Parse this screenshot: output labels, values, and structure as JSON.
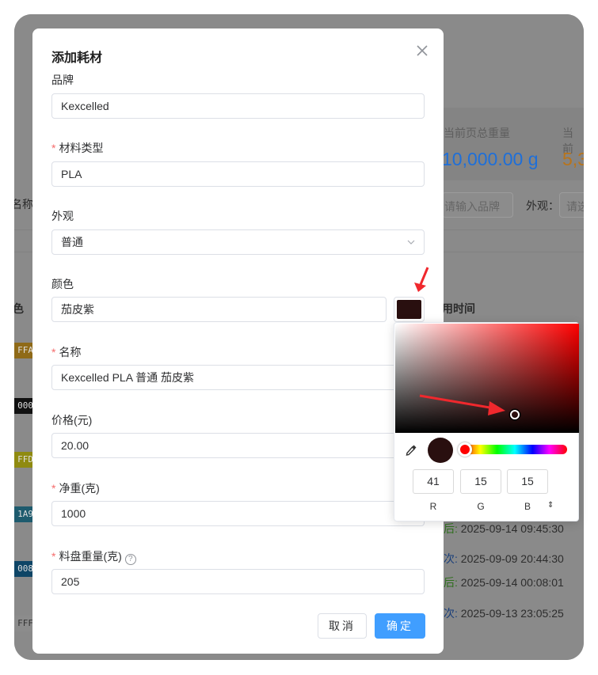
{
  "background": {
    "stat1_label": "当前页总重量",
    "stat1_value": "10,000.00 g",
    "stat1_color": "#1e6fd9",
    "stat2_label": "当前",
    "stat2_value": "5,3",
    "stat2_color": "#b9741a",
    "left_name_label": "名称",
    "brand_placeholder": "请输入品牌",
    "appearance_label": "外观：",
    "appearance_placeholder": "请选",
    "col_color": "色",
    "col_time": "用时间",
    "chips": [
      {
        "text": "FFA",
        "color": "#8f6a18"
      },
      {
        "text": "000",
        "color": "#111111"
      },
      {
        "text": "FFD",
        "color": "#8f8a10"
      },
      {
        "text": "1A9",
        "color": "#1e5b6e"
      },
      {
        "text": "008",
        "color": "#0e4566"
      },
      {
        "text": "FFF",
        "color": "#8c8c8c"
      }
    ],
    "rows": [
      {
        "tag": "后:",
        "time": "2025-09-14 09:45:30"
      },
      {
        "tag": "次:",
        "time": "2025-09-09 20:44:30"
      },
      {
        "tag": "后:",
        "time": "2025-09-14 00:08:01"
      },
      {
        "tag": "次:",
        "time": "2025-09-13 23:05:25"
      }
    ]
  },
  "dialog": {
    "title": "添加耗材",
    "fields": {
      "brand": {
        "label": "品牌",
        "value": "Kexcelled"
      },
      "material_type": {
        "label": "材料类型",
        "value": "PLA",
        "required": true
      },
      "appearance": {
        "label": "外观",
        "value": "普通"
      },
      "color": {
        "label": "颜色",
        "value": "茄皮紫",
        "swatch": "#290f0f"
      },
      "name": {
        "label": "名称",
        "value": "Kexcelled PLA 普通 茄皮紫",
        "required": true
      },
      "price": {
        "label": "价格(元)",
        "value": "20.00"
      },
      "net_weight": {
        "label": "净重(克)",
        "value": "1000",
        "required": true
      },
      "spool_weight": {
        "label": "料盘重量(克)",
        "value": "205",
        "required": true
      }
    },
    "cancel_label": "取消",
    "ok_label": "确定",
    "ok_color": "#409eff"
  },
  "color_picker": {
    "hue_color": "#ff0000",
    "current_color": "#290f0f",
    "r": "41",
    "g": "15",
    "b": "15",
    "r_label": "R",
    "g_label": "G",
    "b_label": "B",
    "toggle_icon": "⇕"
  },
  "annotation_color": "#f0282d"
}
